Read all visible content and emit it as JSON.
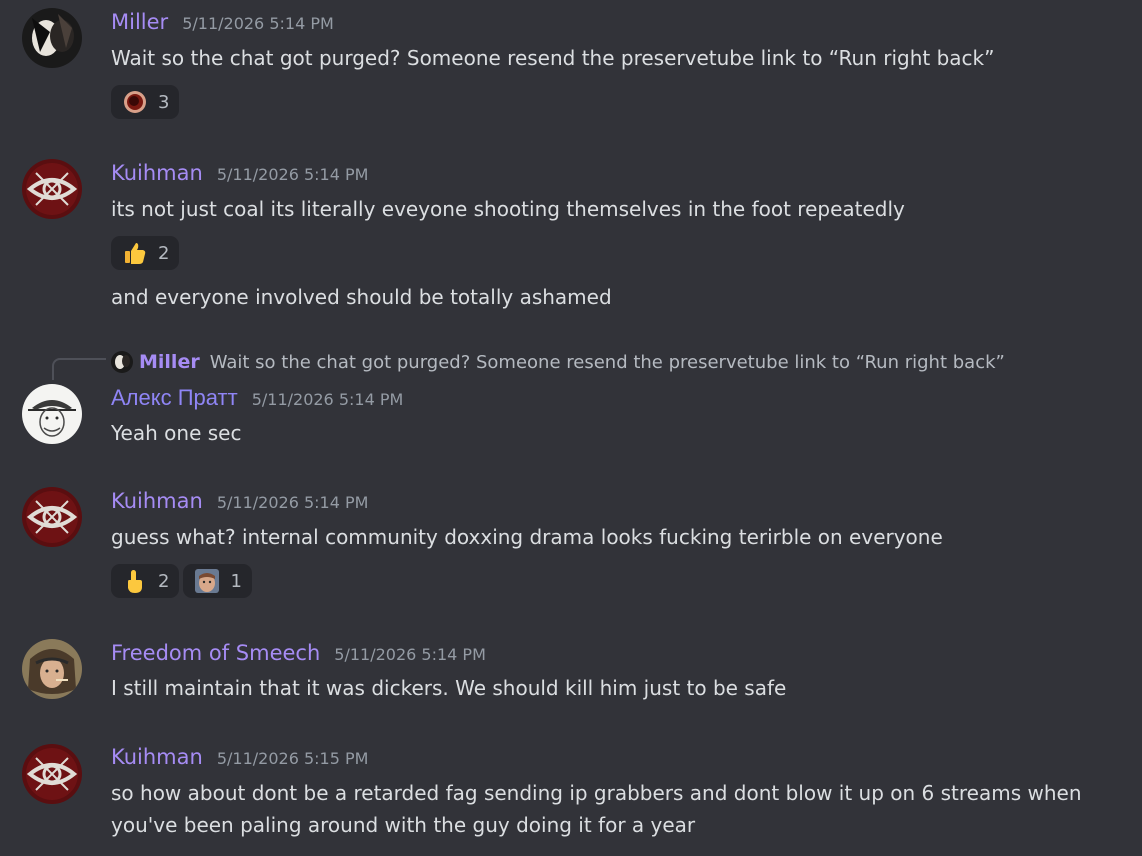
{
  "messages": [
    {
      "username": "Miller",
      "timestamp": "5/11/2026 5:14 PM",
      "text": "Wait so the chat got purged? Someone resend the preservetube link to “Run right back”",
      "reactions": [
        {
          "emoji": "dark-circle-emoji",
          "count": "3"
        }
      ]
    },
    {
      "username": "Kuihman",
      "timestamp": "5/11/2026 5:14 PM",
      "text": "its not just coal its literally eveyone shooting themselves in the foot repeatedly",
      "reactions": [
        {
          "emoji": "thumbs-up-emoji",
          "count": "2"
        }
      ],
      "followup": "and everyone involved should be totally ashamed"
    },
    {
      "username": "Алекс Пратт",
      "timestamp": "5/11/2026 5:14 PM",
      "text": "Yeah one sec",
      "reply": {
        "username": "Miller",
        "text": "Wait so the chat got purged? Someone resend the preservetube link to “Run right back”"
      }
    },
    {
      "username": "Kuihman",
      "timestamp": "5/11/2026 5:14 PM",
      "text": "guess what? internal community doxxing drama looks fucking terirble on everyone",
      "reactions": [
        {
          "emoji": "pointing-up-emoji",
          "count": "2"
        },
        {
          "emoji": "face-custom-emoji",
          "count": "1"
        }
      ]
    },
    {
      "username": "Freedom of Smeech",
      "timestamp": "5/11/2026 5:14 PM",
      "text": "I still maintain that it was dickers. We should kill him just to be safe"
    },
    {
      "username": "Kuihman",
      "timestamp": "5/11/2026 5:15 PM",
      "text": "so how about dont be a retarded fag sending ip grabbers and dont blow it up on 6 streams when you've been paling around with the guy doing it for a year"
    }
  ],
  "colors": {
    "background": "#323339",
    "username": "#a68cf4",
    "timestamp": "#949ba4",
    "text": "#dbdee1",
    "reaction_bg": "#25262b"
  }
}
